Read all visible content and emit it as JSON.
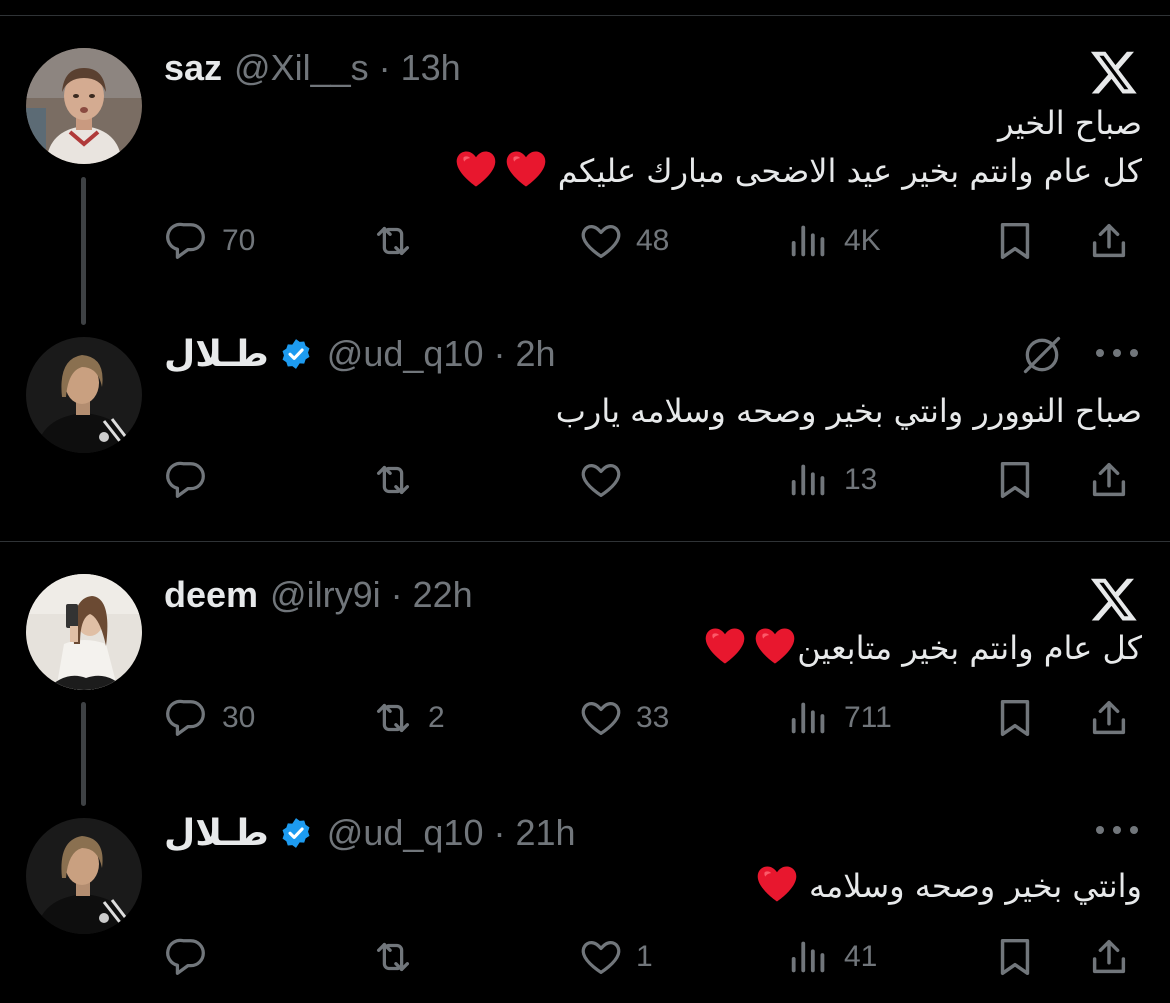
{
  "colors": {
    "background": "#000000",
    "text": "#e7e9ea",
    "muted": "#71767b",
    "verified": "#1d9bf0",
    "heart": "#e8172e",
    "divider": "#2f3336"
  },
  "threads": [
    {
      "root": {
        "name": "saz",
        "handle": "@Xil__s · 13h",
        "lines": [
          "صباح الخير",
          "كل عام وانتم بخير عيد الاضحى مبارك عليكم"
        ],
        "hearts": 2,
        "replies": "70",
        "reposts": "",
        "likes": "48",
        "views": "4K",
        "source_icon": "x-logo-icon"
      },
      "reply": {
        "name": "طـلال",
        "handle": "@ud_q10 · 2h",
        "lines": [
          "صباح النوورر وانتي بخير وصحه وسلامه يارب"
        ],
        "replies": "",
        "reposts": "",
        "likes": "",
        "views": "13",
        "icons": [
          "grok-icon",
          "more-icon"
        ]
      }
    },
    {
      "root": {
        "name": "deem",
        "handle": "@ilry9i · 22h",
        "lines": [
          "كل عام وانتم بخير متابعين"
        ],
        "hearts": 2,
        "replies": "30",
        "reposts": "2",
        "likes": "33",
        "views": "711",
        "source_icon": "x-logo-icon"
      },
      "reply": {
        "name": "طـلال",
        "handle": "@ud_q10 · 21h",
        "lines": [
          "وانتي بخير وصحه وسلامه"
        ],
        "hearts": 1,
        "replies": "",
        "reposts": "",
        "likes": "1",
        "views": "41",
        "icons": [
          "more-icon"
        ]
      }
    }
  ]
}
